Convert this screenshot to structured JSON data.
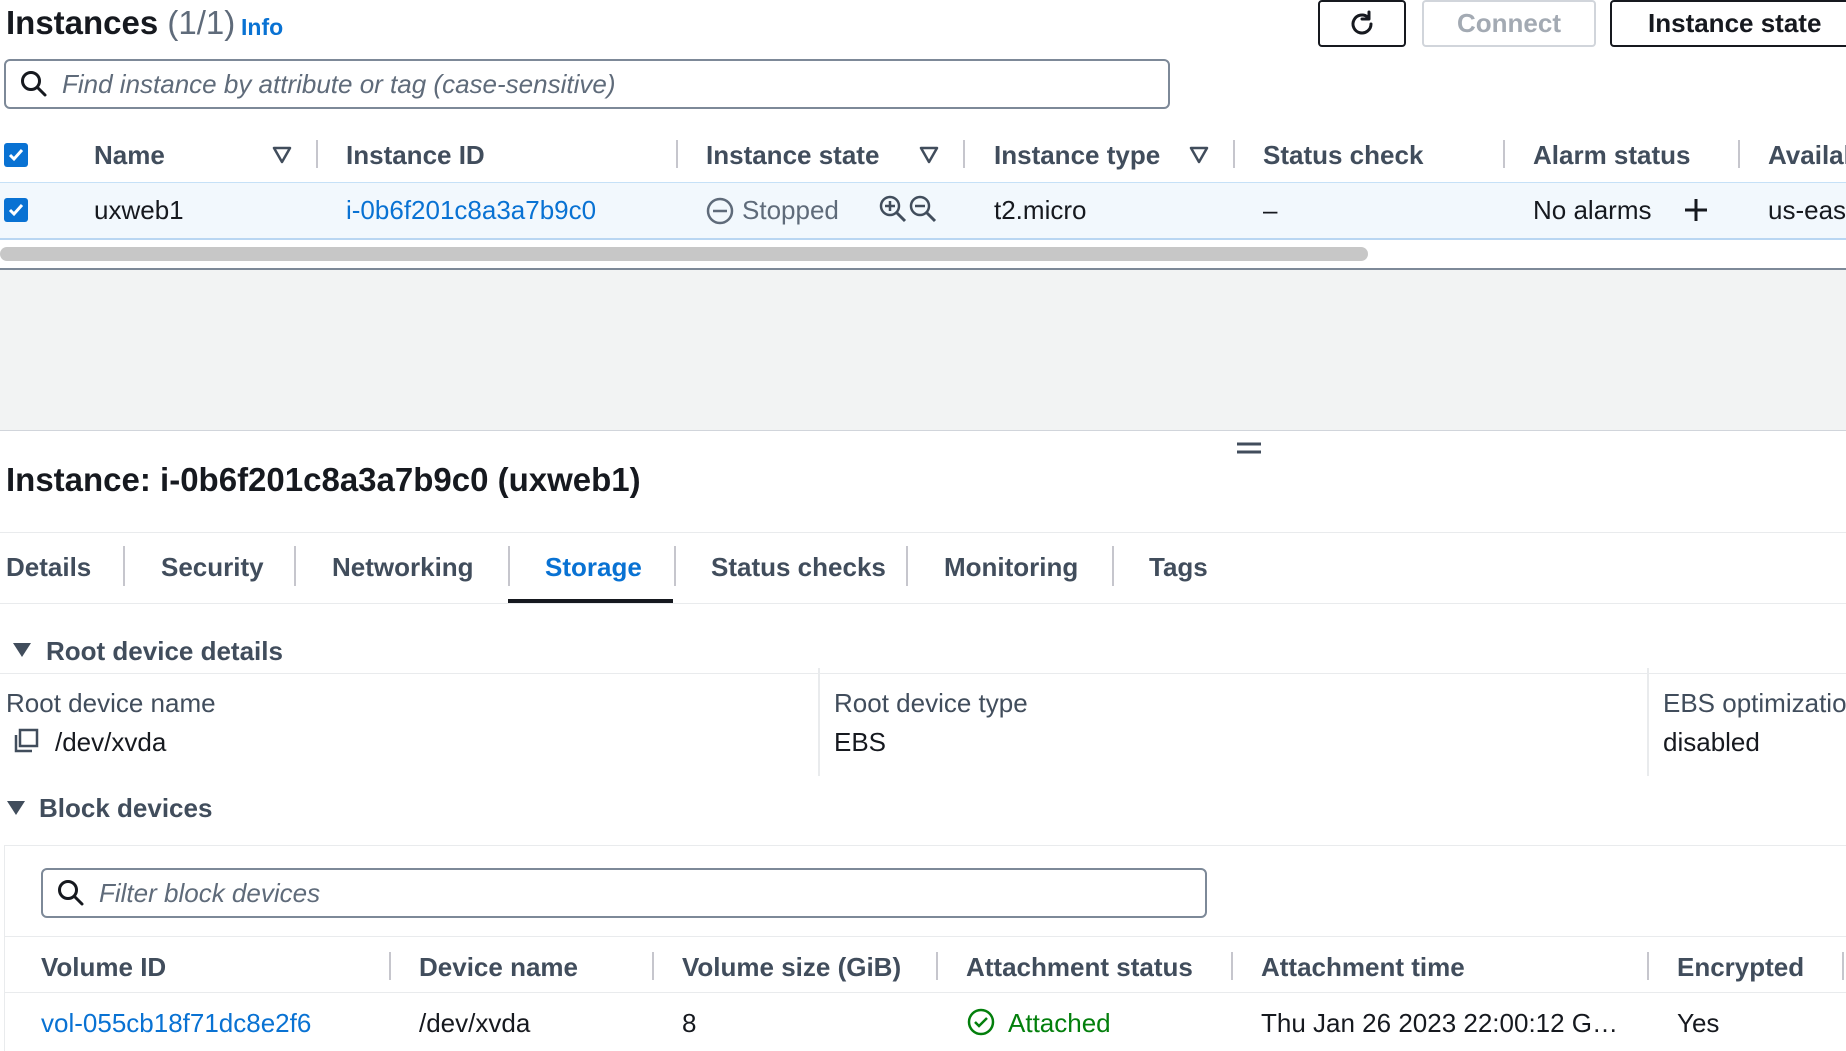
{
  "header": {
    "title": "Instances",
    "count": "(1/1)",
    "info": "Info",
    "buttons": {
      "connect": "Connect",
      "instance_state": "Instance state"
    }
  },
  "search": {
    "placeholder": "Find instance by attribute or tag (case-sensitive)"
  },
  "instances_table": {
    "columns": [
      "Name",
      "Instance ID",
      "Instance state",
      "Instance type",
      "Status check",
      "Alarm status",
      "Availal"
    ],
    "row": {
      "name": "uxweb1",
      "instance_id": "i-0b6f201c8a3a7b9c0",
      "state": "Stopped",
      "type": "t2.micro",
      "status_check": "–",
      "alarm_status": "No alarms",
      "availability": "us-east"
    }
  },
  "details": {
    "title": "Instance: i-0b6f201c8a3a7b9c0 (uxweb1)",
    "tabs": [
      "Details",
      "Security",
      "Networking",
      "Storage",
      "Status checks",
      "Monitoring",
      "Tags"
    ],
    "active_tab": "Storage",
    "root_device": {
      "section_title": "Root device details",
      "name_label": "Root device name",
      "name_value": "/dev/xvda",
      "type_label": "Root device type",
      "type_value": "EBS",
      "ebs_label": "EBS optimizatio",
      "ebs_value": "disabled"
    },
    "block_devices": {
      "section_title": "Block devices",
      "filter_placeholder": "Filter block devices",
      "columns": [
        "Volume ID",
        "Device name",
        "Volume size (GiB)",
        "Attachment status",
        "Attachment time",
        "Encrypted"
      ],
      "row": {
        "volume_id": "vol-055cb18f71dc8e2f6",
        "device_name": "/dev/xvda",
        "size": "8",
        "status": "Attached",
        "time": "Thu Jan 26 2023 22:00:12 G…",
        "encrypted": "Yes"
      }
    }
  },
  "colors": {
    "link": "#0972d3",
    "success": "#037f0c",
    "selected_row": "#f2f8fd"
  }
}
